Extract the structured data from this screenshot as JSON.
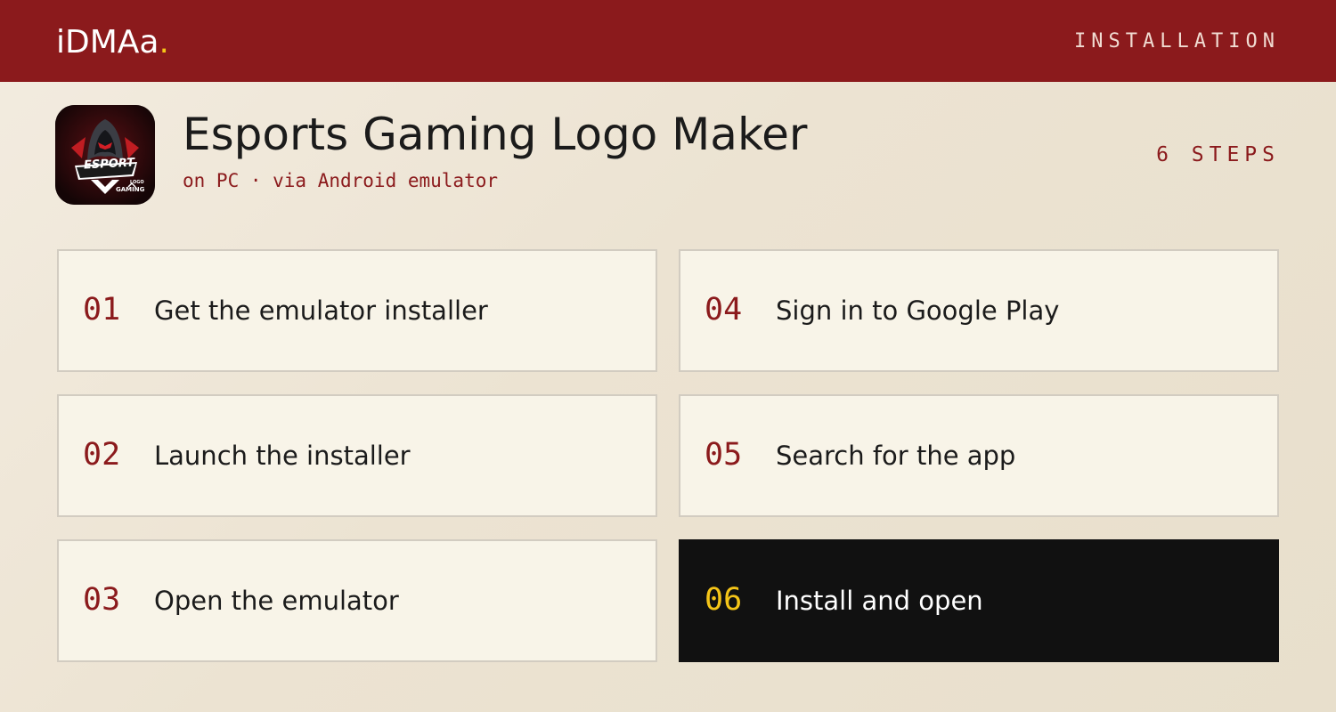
{
  "header": {
    "brand": "iDMAa",
    "brand_dot": ".",
    "section_label": "INSTALLATION"
  },
  "app": {
    "icon": "esport-gaming-logo-icon",
    "icon_text_main": "ESPORT",
    "icon_text_sub": "GAMING",
    "icon_text_tiny": "LOGO",
    "title": "Esports Gaming Logo Maker",
    "subtitle": "on PC · via Android emulator",
    "steps_count": "6 STEPS"
  },
  "steps": [
    {
      "number": "01",
      "label": "Get the emulator installer"
    },
    {
      "number": "02",
      "label": "Launch the installer"
    },
    {
      "number": "03",
      "label": "Open the emulator"
    },
    {
      "number": "04",
      "label": "Sign in to Google Play"
    },
    {
      "number": "05",
      "label": "Search for the app"
    },
    {
      "number": "06",
      "label": "Install and open"
    }
  ],
  "colors": {
    "brand_red": "#8b1a1c",
    "accent_yellow": "#f5c518",
    "card_bg": "#f8f4e8",
    "active_card_bg": "#111111"
  }
}
